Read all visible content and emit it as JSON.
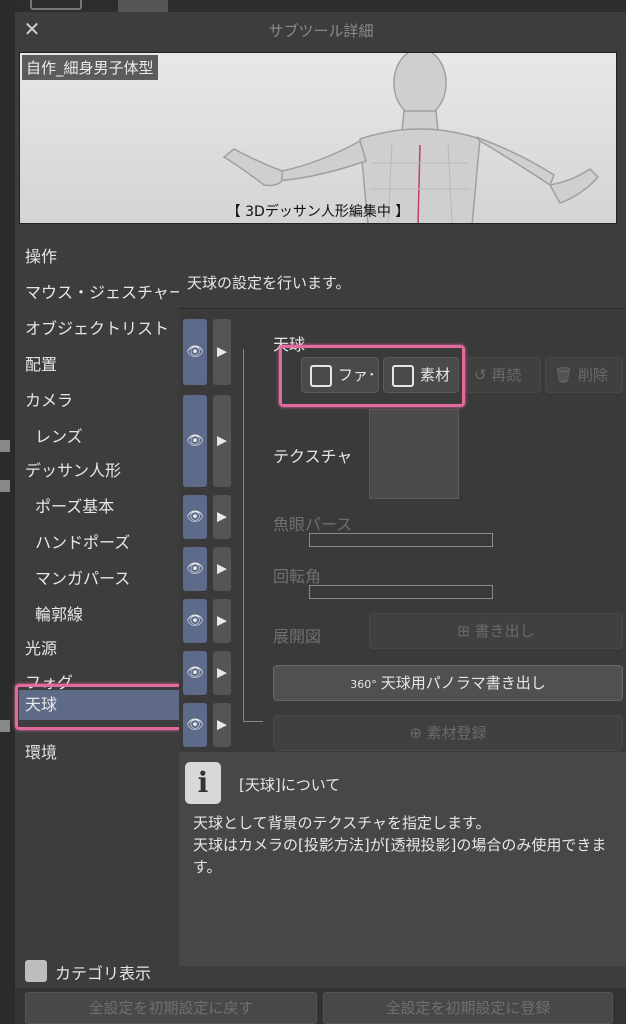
{
  "window": {
    "title": "サブツール詳細",
    "close_glyph": "✕"
  },
  "preview": {
    "name": "自作_細身男子体型",
    "status": "【 3Dデッサン人形編集中 】"
  },
  "categories": [
    {
      "label": "操作"
    },
    {
      "label": "マウス・ジェスチャー"
    },
    {
      "label": "オブジェクトリスト"
    },
    {
      "label": "配置"
    },
    {
      "label": "カメラ"
    },
    {
      "label": "レンズ"
    },
    {
      "label": "デッサン人形"
    },
    {
      "label": "ポーズ基本"
    },
    {
      "label": "ハンドポーズ"
    },
    {
      "label": "マンガパース"
    },
    {
      "label": "輪郭線"
    },
    {
      "label": "光源"
    },
    {
      "label": "フォグ"
    },
    {
      "label": "天球"
    },
    {
      "label": "環境"
    }
  ],
  "category_toggle": {
    "label": "カテゴリ表示"
  },
  "description": "天球の設定を行います。",
  "props": {
    "sky_label": "天球",
    "file_button": "ファ･",
    "material_button": "素材",
    "reload_button": "再読",
    "delete_button": "削除",
    "texture_label": "テクスチャ",
    "fisheye_label": "魚眼パース",
    "rotation_label": "回転角",
    "unfold_label": "展開図",
    "export_button": "書き出し",
    "panorama_badge": "360°",
    "panorama_button": "天球用パノラマ書き出し",
    "register_button": "素材登録",
    "eye_glyph": "👁",
    "tri_glyph": "▶"
  },
  "info": {
    "icon_glyph": "i",
    "title": "[天球]について",
    "line1": "天球として背景のテクスチャを指定します。",
    "line2": "天球はカメラの[投影方法]が[透視投影]の場合のみ使用できます。"
  },
  "bottom": {
    "reset_button": "全設定を初期設定に戻す",
    "register_default_button": "全設定を初期設定に登録"
  },
  "colors": {
    "highlight": "#e36aa0",
    "selected": "#5f6a86",
    "eye_toggle": "#5d6a8a"
  }
}
